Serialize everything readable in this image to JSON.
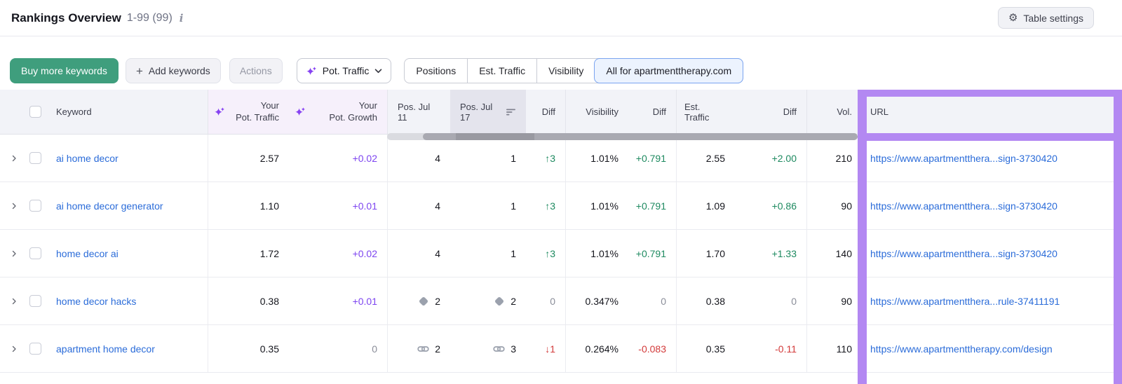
{
  "header": {
    "title": "Rankings Overview",
    "range": "1-99 (99)",
    "table_settings_label": "Table settings"
  },
  "toolbar": {
    "buy_more_label": "Buy more keywords",
    "add_keywords_label": "Add keywords",
    "actions_label": "Actions",
    "metric_dropdown_label": "Pot. Traffic",
    "segments": [
      {
        "label": "Positions",
        "active": false
      },
      {
        "label": "Est. Traffic",
        "active": false
      },
      {
        "label": "Visibility",
        "active": false
      },
      {
        "label": "All for apartmenttherapy.com",
        "active": true
      }
    ]
  },
  "table": {
    "columns": {
      "keyword": "Keyword",
      "pot_traffic_line1": "Your",
      "pot_traffic_line2": "Pot. Traffic",
      "pot_growth_line1": "Your",
      "pot_growth_line2": "Pot. Growth",
      "pos_jul11": "Pos. Jul 11",
      "pos_jul17": "Pos. Jul 17",
      "diff1": "Diff",
      "visibility": "Visibility",
      "diff2": "Diff",
      "est_traffic": "Est. Traffic",
      "diff3": "Diff",
      "volume": "Vol.",
      "url": "URL"
    },
    "sorted_column": "Pos. Jul 17",
    "rows": [
      {
        "keyword": "ai home decor",
        "your_pot_traffic": "2.57",
        "your_pot_growth": "+0.02",
        "pos_jul11": "4",
        "pos_jul17": "1",
        "pos_diff": "↑3",
        "visibility": "1.01%",
        "visibility_diff": "+0.791",
        "est_traffic": "2.55",
        "est_traffic_diff": "+2.00",
        "volume": "210",
        "url": "https://www.apartmentthera...sign-3730420"
      },
      {
        "keyword": "ai home decor generator",
        "your_pot_traffic": "1.10",
        "your_pot_growth": "+0.01",
        "pos_jul11": "4",
        "pos_jul17": "1",
        "pos_diff": "↑3",
        "visibility": "1.01%",
        "visibility_diff": "+0.791",
        "est_traffic": "1.09",
        "est_traffic_diff": "+0.86",
        "volume": "90",
        "url": "https://www.apartmentthera...sign-3730420"
      },
      {
        "keyword": "home decor ai",
        "your_pot_traffic": "1.72",
        "your_pot_growth": "+0.02",
        "pos_jul11": "4",
        "pos_jul17": "1",
        "pos_diff": "↑3",
        "visibility": "1.01%",
        "visibility_diff": "+0.791",
        "est_traffic": "1.70",
        "est_traffic_diff": "+1.33",
        "volume": "140",
        "url": "https://www.apartmentthera...sign-3730420"
      },
      {
        "keyword": "home decor hacks",
        "your_pot_traffic": "0.38",
        "your_pot_growth": "+0.01",
        "pos_jul11": "2",
        "pos_jul17": "2",
        "pos_diff": "0",
        "pos_icon": "featured-snippet-icon",
        "visibility": "0.347%",
        "visibility_diff": "0",
        "est_traffic": "0.38",
        "est_traffic_diff": "0",
        "volume": "90",
        "url": "https://www.apartmentthera...rule-37411191"
      },
      {
        "keyword": "apartment home decor",
        "your_pot_traffic": "0.35",
        "your_pot_growth": "0",
        "pos_jul11": "2",
        "pos_jul17": "3",
        "pos_diff": "↓1",
        "pos_icon": "link-icon",
        "visibility": "0.264%",
        "visibility_diff": "-0.083",
        "est_traffic": "0.35",
        "est_traffic_diff": "-0.11",
        "volume": "110",
        "url": "https://www.apartmenttherapy.com/design"
      }
    ]
  },
  "icons": {
    "title_info": "info-icon",
    "settings_gear": "gear-icon",
    "add_plus": "plus-icon",
    "ai_sparkles": "ai-sparkles-icon",
    "dropdown_chevron": "chevron-down-icon",
    "sort": "sort-descending-icon",
    "row_expand": "chevron-right-icon",
    "featured_snippet": "featured-snippet-icon",
    "link": "link-icon"
  },
  "colors": {
    "buy_button_green": "#3f9e7d",
    "annotation_purple": "#b388f2",
    "ai_purple": "#7d44f0",
    "positive_green": "#1e8a60",
    "negative_red": "#d33a3a",
    "neutral_gray": "#8a8d99",
    "link_blue": "#2b6cd9",
    "active_segment_border": "#7aa4f0"
  }
}
